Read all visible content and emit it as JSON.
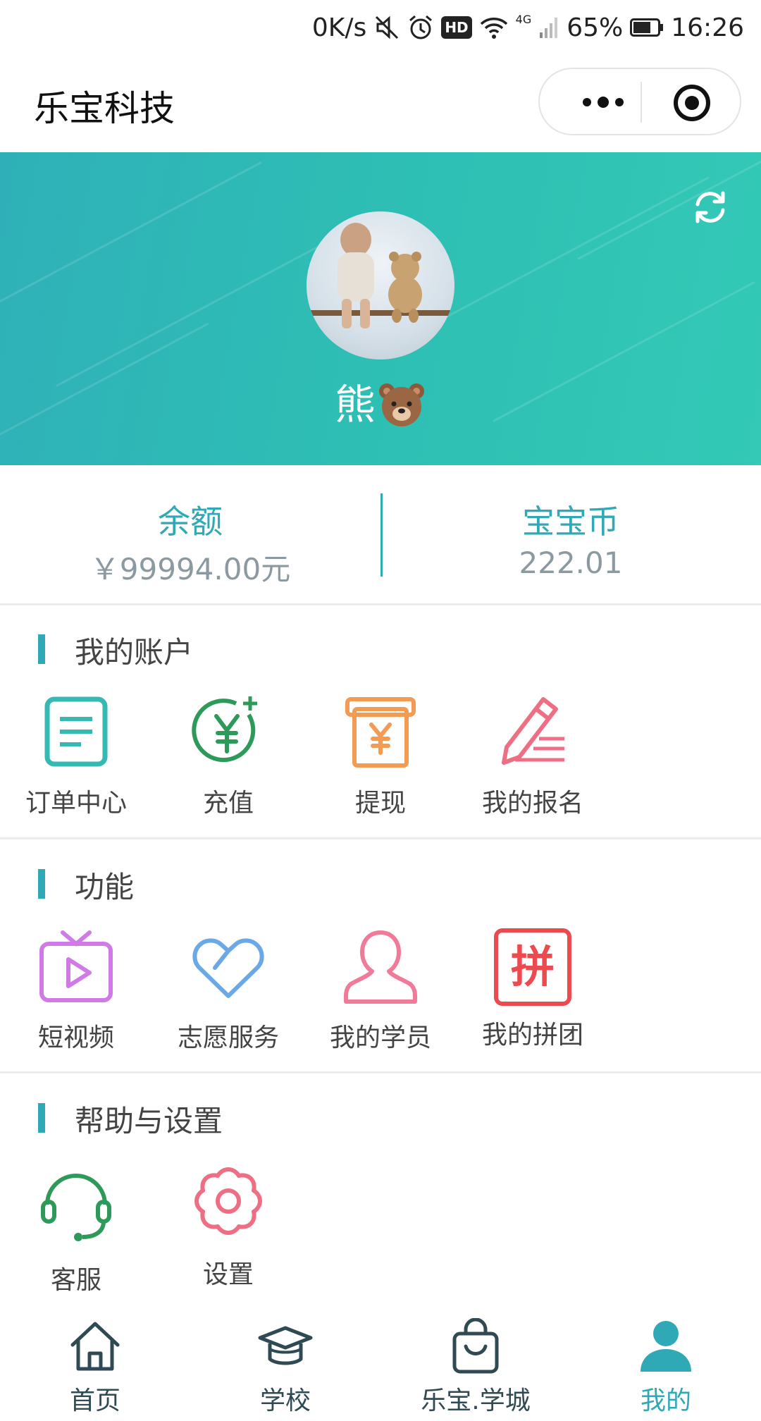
{
  "status_bar": {
    "net_speed": "0K/s",
    "hd": "HD",
    "network": "4G",
    "battery": "65%",
    "time": "16:26"
  },
  "nav": {
    "title": "乐宝科技"
  },
  "profile": {
    "nickname": "熊"
  },
  "stats": [
    {
      "label": "余额",
      "value": "￥99994.00元"
    },
    {
      "label": "宝宝币",
      "value": "222.01"
    }
  ],
  "account_section": {
    "title": "我的账户",
    "items": [
      {
        "label": "订单中心",
        "icon": "order-list-icon",
        "color": "#36b8b3"
      },
      {
        "label": "充值",
        "icon": "recharge-icon",
        "color": "#2e9a5a"
      },
      {
        "label": "提现",
        "icon": "withdraw-icon",
        "color": "#f39b52"
      },
      {
        "label": "我的报名",
        "icon": "signup-pen-icon",
        "color": "#ee6f84"
      }
    ]
  },
  "function_section": {
    "title": "功能",
    "items": [
      {
        "label": "短视频",
        "icon": "video-tv-icon",
        "color": "#d07ae8"
      },
      {
        "label": "志愿服务",
        "icon": "heart-icon",
        "color": "#6aa8e6"
      },
      {
        "label": "我的学员",
        "icon": "student-icon",
        "color": "#f07a97"
      },
      {
        "label": "我的拼团",
        "icon": "group-buy-icon",
        "color": "#ec4a4f"
      }
    ]
  },
  "help_section": {
    "title": "帮助与设置",
    "items": [
      {
        "label": "客服",
        "icon": "headset-icon",
        "color": "#2e9a5a"
      },
      {
        "label": "设置",
        "icon": "settings-flower-icon",
        "color": "#ee6f84"
      }
    ],
    "group_buy_glyph": "拼"
  },
  "tabbar": [
    {
      "label": "首页",
      "icon": "home-icon",
      "active": false
    },
    {
      "label": "学校",
      "icon": "graduation-cap-icon",
      "active": false
    },
    {
      "label": "乐宝.学城",
      "icon": "shopping-bag-icon",
      "active": false
    },
    {
      "label": "我的",
      "icon": "user-icon",
      "active": true
    }
  ],
  "colors": {
    "accent": "#2ea9b5",
    "banner_start": "#2fb0b8",
    "banner_end": "#33c9b6",
    "tab_text": "#2f4a53"
  }
}
